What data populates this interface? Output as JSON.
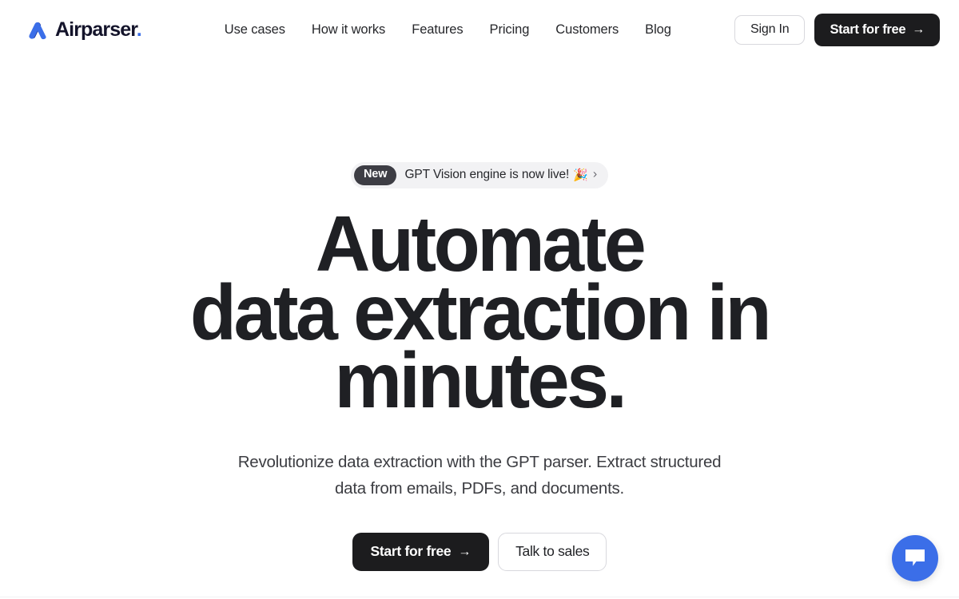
{
  "header": {
    "brand": {
      "name": "Airparser",
      "dot": ".",
      "logo_icon": "airparser-chevron-logo",
      "colors": {
        "dark_stroke": "#1e3a9e",
        "light_stroke": "#3b6ee8",
        "wordmark": "#14142b",
        "dot": "#3b6ee8"
      }
    },
    "nav": [
      {
        "label": "Use cases"
      },
      {
        "label": "How it works"
      },
      {
        "label": "Features"
      },
      {
        "label": "Pricing"
      },
      {
        "label": "Customers"
      },
      {
        "label": "Blog"
      }
    ],
    "sign_in_label": "Sign In",
    "start_label": "Start for free",
    "start_arrow": "→"
  },
  "hero": {
    "announcement": {
      "badge": "New",
      "text": "GPT Vision engine is now live!",
      "emoji": "🎉",
      "chevron": "›",
      "badge_bg": "#3d3d44",
      "pill_bg": "#f2f2f4"
    },
    "title_lines": [
      "Automate",
      "data extraction in",
      "minutes."
    ],
    "subtitle": "Revolutionize data extraction with the GPT parser. Extract structured data from emails, PDFs, and documents.",
    "primary_cta": {
      "label": "Start for free",
      "arrow": "→",
      "bg": "#1c1c1e"
    },
    "secondary_cta": {
      "label": "Talk to sales"
    }
  },
  "chat_widget": {
    "icon": "chat-bubble-icon",
    "color": "#3b6ee8"
  }
}
